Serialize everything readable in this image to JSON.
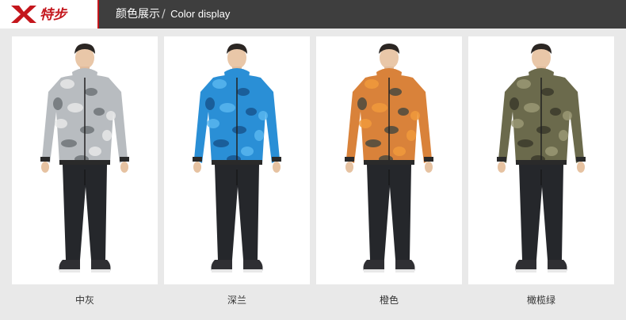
{
  "brand": {
    "logo_text": "特步",
    "accent_color": "#c4161c"
  },
  "header": {
    "title_zh": "颜色展示",
    "separator": "/",
    "title_en": "Color display"
  },
  "products": [
    {
      "label": "中灰",
      "jacket_color": "#b8bcc0",
      "camo_a": "#e6e7e8",
      "camo_b": "#6f7478"
    },
    {
      "label": "深兰",
      "jacket_color": "#2a8fd6",
      "camo_a": "#58b6ee",
      "camo_b": "#17568f"
    },
    {
      "label": "橙色",
      "jacket_color": "#d9823a",
      "camo_a": "#f09a3c",
      "camo_b": "#4a4a3f"
    },
    {
      "label": "橄榄绿",
      "jacket_color": "#6b6a4c",
      "camo_a": "#9a9874",
      "camo_b": "#3b3a2b"
    }
  ]
}
